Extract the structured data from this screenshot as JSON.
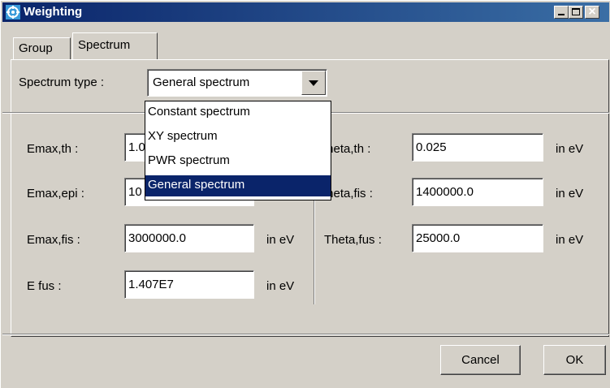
{
  "window": {
    "title": "Weighting",
    "icon": "app-icon"
  },
  "tabs": {
    "group_label": "Group",
    "spectrum_label": "Spectrum",
    "active": "Spectrum"
  },
  "spectrum": {
    "type_label": "Spectrum type :",
    "selected_value": "General spectrum",
    "options": [
      "Constant spectrum",
      "XY spectrum",
      "PWR spectrum",
      "General spectrum"
    ]
  },
  "fields_left": [
    {
      "label": "Emax,th :",
      "value": "1.0",
      "unit": ""
    },
    {
      "label": "Emax,epi :",
      "value": "10",
      "unit": ""
    },
    {
      "label": "Emax,fis :",
      "value": "3000000.0",
      "unit": "in eV"
    },
    {
      "label": "E fus :",
      "value": "1.407E7",
      "unit": "in eV"
    }
  ],
  "fields_right": [
    {
      "label": "Theta,th :",
      "value": "0.025",
      "unit": "in eV"
    },
    {
      "label": "Theta,fis :",
      "value": "1400000.0",
      "unit": "in eV"
    },
    {
      "label": "Theta,fus :",
      "value": "25000.0",
      "unit": "in eV"
    }
  ],
  "buttons": {
    "cancel": "Cancel",
    "ok": "OK"
  },
  "colors": {
    "titlebar_start": "#0a246a",
    "titlebar_end": "#3a6ea5",
    "selection": "#0a246a",
    "face": "#d4d0c8"
  }
}
